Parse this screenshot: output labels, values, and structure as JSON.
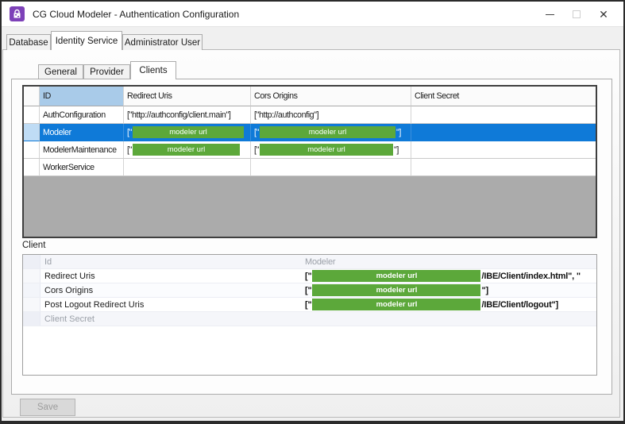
{
  "window": {
    "title": "CG Cloud Modeler - Authentication Configuration",
    "controls": {
      "close_glyph": "✕"
    }
  },
  "outer_tabs": {
    "database": "Database",
    "identity_service": "Identity Service",
    "administrator_user": "Administrator User",
    "selected": "Identity Service"
  },
  "inner_tabs": {
    "general": "General",
    "provider": "Provider",
    "clients": "Clients",
    "selected": "Clients"
  },
  "grid": {
    "columns": {
      "id": "ID",
      "redirect": "Redirect Uris",
      "cors": "Cors Origins",
      "secret": "Client Secret"
    },
    "rows": [
      {
        "id": "AuthConfiguration",
        "redirect_text": "[\"http://authconfig/client.main\"]",
        "cors_text": "[\"http://authconfig\"]",
        "secret_text": ""
      },
      {
        "id": "Modeler",
        "selected": true,
        "redirect_prefix": "[\"",
        "redirect_redacted": "modeler url",
        "redirect_suffix": "",
        "cors_prefix": "[\"",
        "cors_redacted": "modeler url",
        "cors_suffix": "\"]",
        "secret_text": ""
      },
      {
        "id": "ModelerMaintenance",
        "redirect_prefix": "[\"",
        "redirect_redacted": "modeler url",
        "redirect_suffix": "",
        "cors_prefix": "[\"",
        "cors_redacted": "modeler url",
        "cors_suffix": "\"]",
        "secret_text": ""
      },
      {
        "id": "WorkerService",
        "redirect_text": "",
        "cors_text": "",
        "secret_text": ""
      }
    ]
  },
  "detail": {
    "caption": "Client",
    "rows": [
      {
        "label": "Id",
        "value": "Modeler"
      },
      {
        "label": "Redirect Uris",
        "prefix": "[\"",
        "redacted": "modeler url",
        "suffix": "/IBE/Client/index.html\", \""
      },
      {
        "label": "Cors Origins",
        "prefix": "[\"",
        "redacted": "modeler url",
        "suffix": "\"]"
      },
      {
        "label": "Post Logout Redirect Uris",
        "prefix": "[\"",
        "redacted": "modeler url",
        "suffix": "/IBE/Client/logout\"]"
      },
      {
        "label": "Client Secret",
        "value": ""
      }
    ]
  },
  "save_button": {
    "label": "Save"
  },
  "colors": {
    "selection_blue": "#0F7AD8",
    "redaction_green": "#5CA83A",
    "sorted_header_blue": "#A9CBE9",
    "app_icon_purple": "#7D41B8",
    "grid_background_gray": "#ABABAB"
  }
}
